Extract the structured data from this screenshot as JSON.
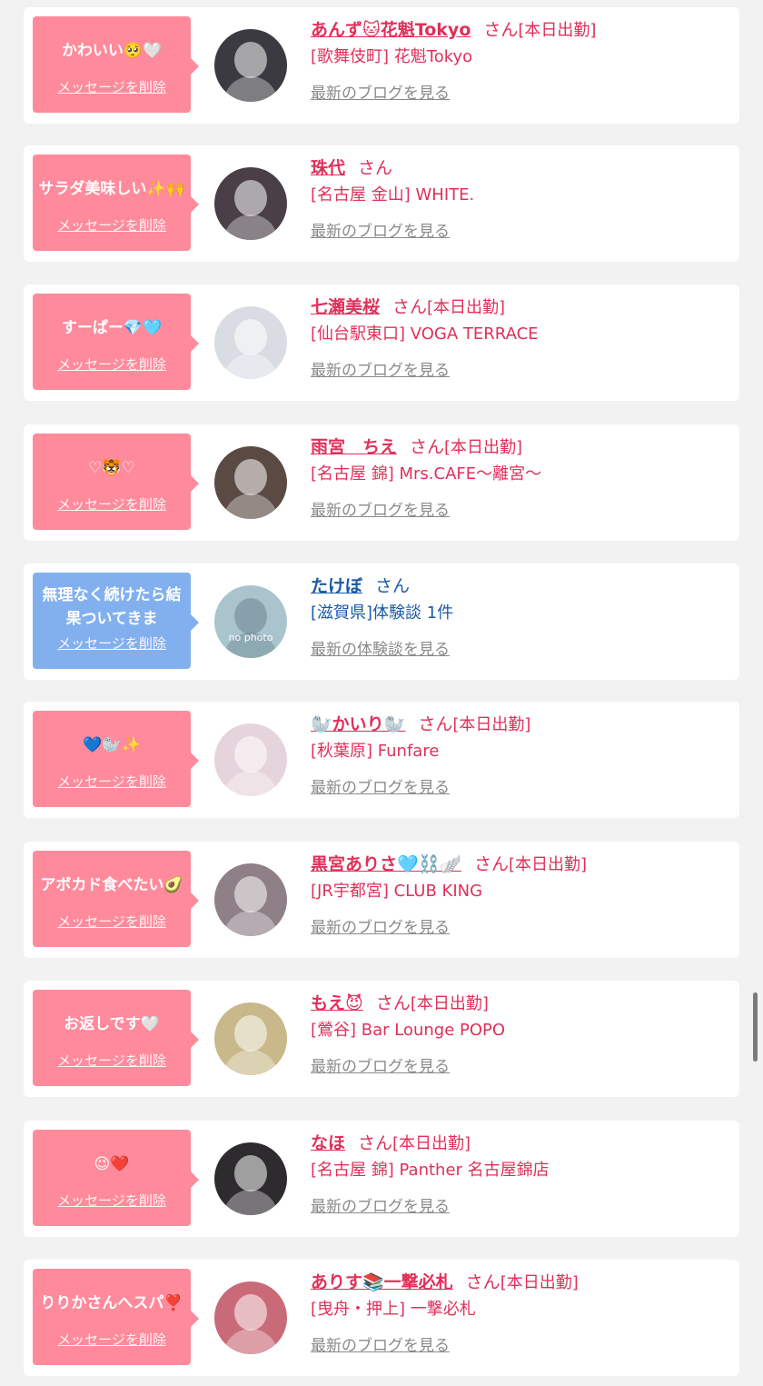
{
  "colors": {
    "pink_accent": "#e0305a",
    "bubble_pink": "#ff8a9b",
    "bubble_blue": "#82b0ef",
    "male_blue": "#1a5aa8",
    "link_gray": "#8a8a8a"
  },
  "common": {
    "delete_label": "メッセージを削除",
    "san": "さん",
    "blog_label": "最新のブログを見る"
  },
  "items": [
    {
      "message": "かわいい🥺🤍",
      "name": "あんず🐱花魁Tokyo",
      "san": "さん",
      "status": "[本日出勤]",
      "shop": "[歌舞伎町] 花魁Tokyo",
      "link": "最新のブログを見る",
      "delete": "メッセージを削除",
      "avatar_color": "#3a3a40"
    },
    {
      "message": "サラダ美味しい✨🙌",
      "name": "珠代",
      "san": "さん",
      "status": "",
      "shop": "[名古屋 金山] WHITE.",
      "link": "最新のブログを見る",
      "delete": "メッセージを削除",
      "avatar_color": "#4a3f46"
    },
    {
      "message": "すーぱー💎🩵",
      "name": "七瀬美桜",
      "san": "さん",
      "status": "[本日出勤]",
      "shop": "[仙台駅東口] VOGA TERRACE",
      "link": "最新のブログを見る",
      "delete": "メッセージを削除",
      "avatar_color": "#d9dde3"
    },
    {
      "message": "♡🐯♡",
      "name": "雨宮　ちえ",
      "san": "さん",
      "status": "[本日出勤]",
      "shop": "[名古屋 錦] Mrs.CAFE～離宮～",
      "link": "最新のブログを見る",
      "delete": "メッセージを削除",
      "avatar_color": "#5b4a44"
    },
    {
      "message": "無理なく続けたら結果ついてきま",
      "name": "たけぼ",
      "san": "さん",
      "status": "",
      "shop": "[滋賀県]体験談 1件",
      "link": "最新の体験談を見る",
      "delete": "メッセージを削除",
      "avatar_color": "#a9c4cd",
      "avatar_text": "no photo",
      "blue": true
    },
    {
      "message": "💙🦭✨",
      "name": "🦭かいり🦭",
      "san": "さん",
      "status": "[本日出勤]",
      "shop": "[秋葉原] Funfare",
      "link": "最新のブログを見る",
      "delete": "メッセージを削除",
      "avatar_color": "#e6d4dc"
    },
    {
      "message": "アボカド食べたい🥑",
      "name": "黒宮ありさ🩵⛓️🪽",
      "san": "さん",
      "status": "[本日出勤]",
      "shop": "[JR宇都宮] CLUB KING",
      "link": "最新のブログを見る",
      "delete": "メッセージを削除",
      "avatar_color": "#8f7f86"
    },
    {
      "message": "お返しです🤍",
      "name": "もえ😈",
      "san": "さん",
      "status": "[本日出勤]",
      "shop": "[鶯谷] Bar Lounge POPO",
      "link": "最新のブログを見る",
      "delete": "メッセージを削除",
      "avatar_color": "#c8b88a"
    },
    {
      "message": "😉❤️",
      "name": "なほ",
      "san": "さん",
      "status": "[本日出勤]",
      "shop": "[名古屋 錦] Panther 名古屋錦店",
      "link": "最新のブログを見る",
      "delete": "メッセージを削除",
      "avatar_color": "#2e2b2e"
    },
    {
      "message": "りりかさんへスパ❣️",
      "name": "ありす📚一撃必札",
      "san": "さん",
      "status": "[本日出勤]",
      "shop": "[曳舟・押上] 一撃必札",
      "link": "最新のブログを見る",
      "delete": "メッセージを削除",
      "avatar_color": "#c96a78"
    }
  ]
}
